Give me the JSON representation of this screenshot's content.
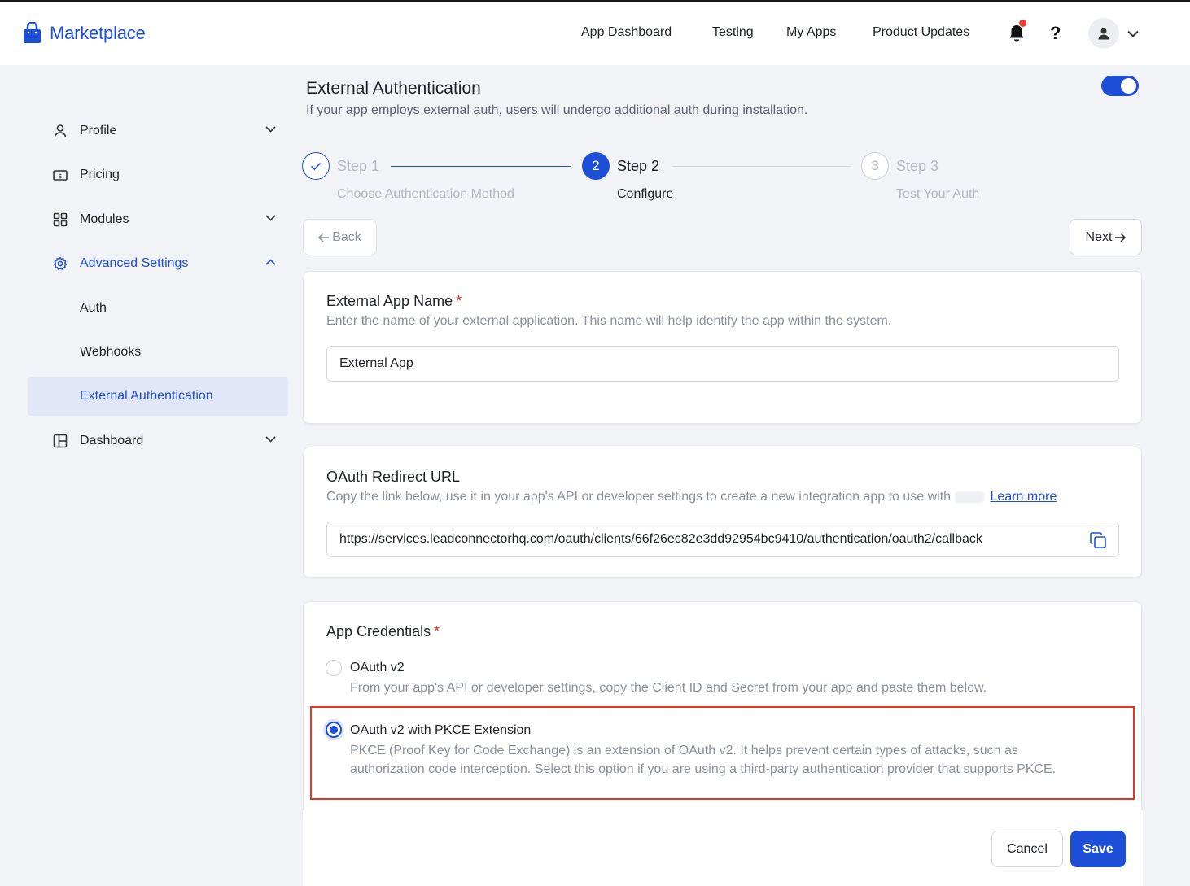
{
  "header": {
    "brand": "Marketplace",
    "nav": [
      "App Dashboard",
      "Testing",
      "My Apps",
      "Product Updates"
    ],
    "help": "?"
  },
  "sidebar": {
    "items": [
      {
        "label": "Profile",
        "icon": "user-icon"
      },
      {
        "label": "Pricing",
        "icon": "pricing-icon"
      },
      {
        "label": "Modules",
        "icon": "grid-icon"
      },
      {
        "label": "Advanced Settings",
        "icon": "gear-icon"
      },
      {
        "label": "Auth"
      },
      {
        "label": "Webhooks"
      },
      {
        "label": "External Authentication"
      },
      {
        "label": "Dashboard",
        "icon": "dashboard-icon"
      }
    ]
  },
  "main": {
    "title": "External Authentication",
    "subtitle": "If your app employs external auth, users will undergo additional auth during installation.",
    "enabled": true,
    "steps": [
      {
        "number": "1",
        "title": "Step 1",
        "sub": "Choose Authentication Method",
        "state": "done"
      },
      {
        "number": "2",
        "title": "Step 2",
        "sub": "Configure",
        "state": "current"
      },
      {
        "number": "3",
        "title": "Step 3",
        "sub": "Test Your Auth",
        "state": "pending"
      }
    ],
    "back_label": "Back",
    "next_label": "Next"
  },
  "app_name_card": {
    "title": "External App Name",
    "required": "*",
    "desc": "Enter the name of your external application. This name will help identify the app within the system.",
    "value": "External App"
  },
  "redirect_card": {
    "title": "OAuth Redirect URL",
    "desc": "Copy the link below, use it in your app's API or developer settings to create a new integration app to use with",
    "learn_more": "Learn more",
    "url": "https://services.leadconnectorhq.com/oauth/clients/66f26ec82e3dd92954bc9410/authentication/oauth2/callback"
  },
  "credentials_card": {
    "title": "App Credentials",
    "required": "*",
    "options": [
      {
        "label": "OAuth v2",
        "desc1": "From your app's API or developer settings, copy the Client ID and Secret from your app and paste them below.",
        "checked": false
      },
      {
        "label": "OAuth v2 with PKCE Extension",
        "desc1": "PKCE (Proof Key for Code Exchange) is an extension of OAuth v2. It helps prevent certain types of attacks, such as",
        "desc2": "authorization code interception. Select this option if you are using a third-party authentication provider that supports PKCE.",
        "checked": true
      }
    ]
  },
  "footer": {
    "cancel": "Cancel",
    "save": "Save"
  },
  "colors": {
    "accent": "#1d4ed8",
    "highlight": "#e6341f",
    "notification_dot": "#ef3b36"
  }
}
